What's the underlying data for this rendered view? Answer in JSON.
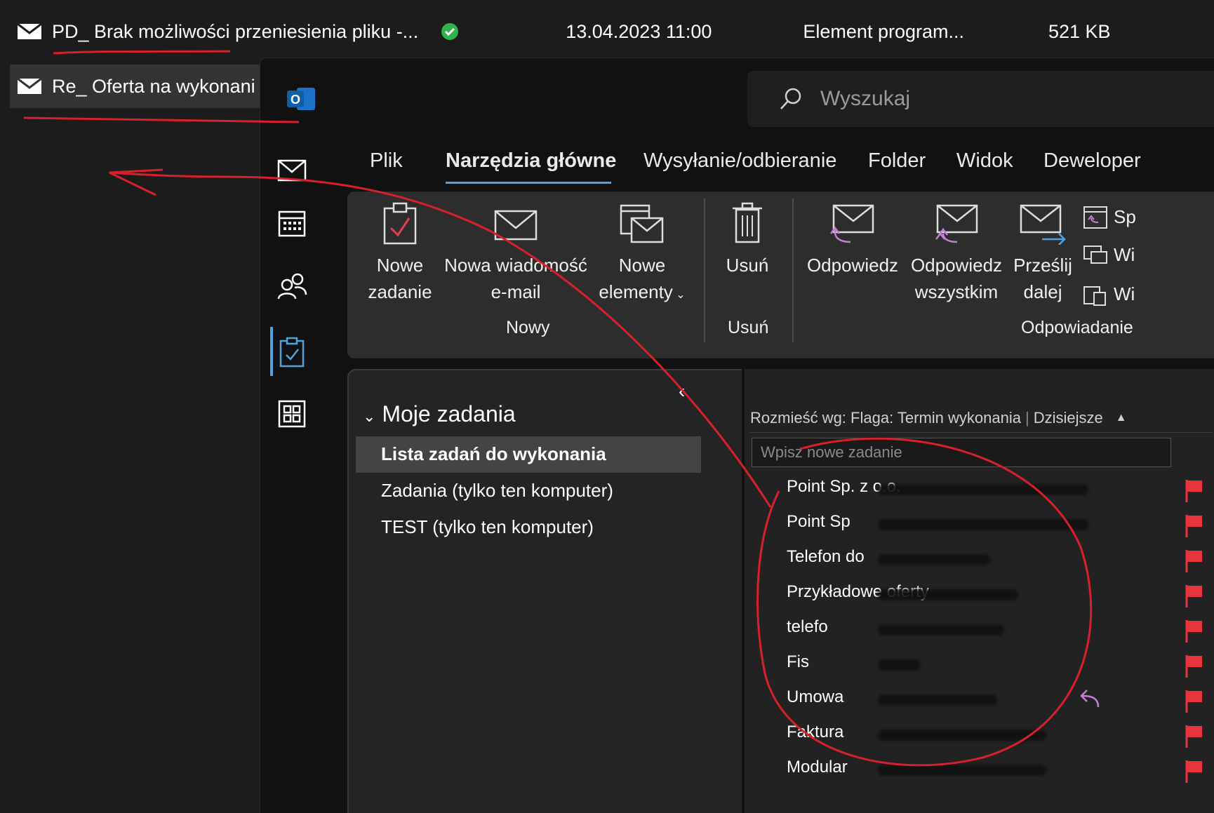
{
  "files": [
    {
      "name": "PD_ Brak możliwości przeniesienia pliku -...",
      "date": "13.04.2023 11:00",
      "type": "Element program...",
      "size": "521 KB"
    },
    {
      "name": "Re_ Oferta na wykonani"
    }
  ],
  "outlook": {
    "search_placeholder": "Wyszukaj",
    "tabs": [
      "Plik",
      "Narzędzia główne",
      "Wysyłanie/odbieranie",
      "Folder",
      "Widok",
      "Deweloper"
    ],
    "ribbon": {
      "new_task": [
        "Nowe",
        "zadanie"
      ],
      "new_email": [
        "Nowa wiadomość",
        "e-mail"
      ],
      "new_items": [
        "Nowe",
        "elementy"
      ],
      "delete": "Usuń",
      "reply": "Odpowiedz",
      "reply_all": [
        "Odpowiedz",
        "wszystkim"
      ],
      "forward": [
        "Prześlij",
        "dalej"
      ],
      "cut_items": [
        "Sp",
        "Wi",
        "Wi"
      ],
      "groups": {
        "new": "Nowy",
        "delete": "Usuń",
        "respond": "Odpowiadanie"
      }
    },
    "folders": {
      "header": "Moje zadania",
      "items": [
        "Lista zadań do wykonania",
        "Zadania (tylko ten komputer)",
        "TEST (tylko ten komputer)"
      ]
    },
    "tasks": {
      "sort_label": "Rozmieść wg: Flaga: Termin wykonania",
      "sort_value": "Dzisiejsze",
      "new_task_placeholder": "Wpisz nowe zadanie",
      "items": [
        "Point Sp. z o.o.",
        "Point Sp",
        "Telefon do",
        "Przykładowe oferty",
        "telefo",
        "Fis",
        "Umowa",
        "Faktura",
        "Modular"
      ]
    }
  },
  "colors": {
    "accent": "#4fa3e0",
    "flag": "#e8343c",
    "annotation": "#d8202c",
    "reply": "#c77dd8"
  }
}
